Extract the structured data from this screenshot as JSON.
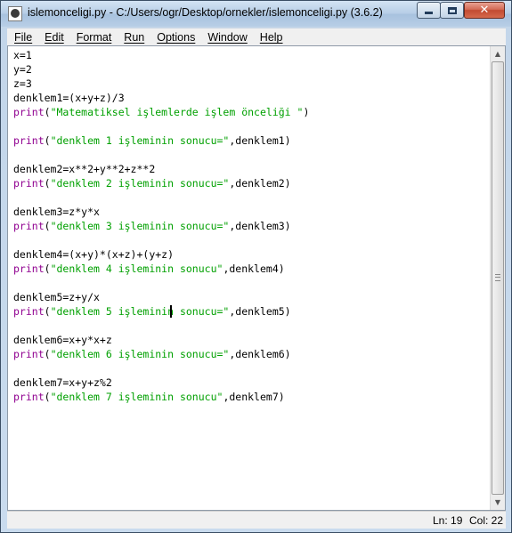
{
  "window": {
    "title": "islemonceligi.py - C:/Users/ogr/Desktop/ornekler/islemonceligi.py (3.6.2)"
  },
  "menubar": {
    "items": [
      {
        "label": "File"
      },
      {
        "label": "Edit"
      },
      {
        "label": "Format"
      },
      {
        "label": "Run"
      },
      {
        "label": "Options"
      },
      {
        "label": "Window"
      },
      {
        "label": "Help"
      }
    ]
  },
  "editor": {
    "lines": [
      [
        {
          "t": "x=1",
          "c": "txt"
        }
      ],
      [
        {
          "t": "y=2",
          "c": "txt"
        }
      ],
      [
        {
          "t": "z=3",
          "c": "txt"
        }
      ],
      [
        {
          "t": "denklem1=(x+y+z)/3",
          "c": "txt"
        }
      ],
      [
        {
          "t": "print",
          "c": "kw"
        },
        {
          "t": "(",
          "c": "txt"
        },
        {
          "t": "\"Matematiksel işlemlerde işlem önceliği \"",
          "c": "str"
        },
        {
          "t": ")",
          "c": "txt"
        }
      ],
      [],
      [
        {
          "t": "print",
          "c": "kw"
        },
        {
          "t": "(",
          "c": "txt"
        },
        {
          "t": "\"denklem 1 işleminin sonucu=\"",
          "c": "str"
        },
        {
          "t": ",denklem1)",
          "c": "txt"
        }
      ],
      [],
      [
        {
          "t": "denklem2=x**2+y**2+z**2",
          "c": "txt"
        }
      ],
      [
        {
          "t": "print",
          "c": "kw"
        },
        {
          "t": "(",
          "c": "txt"
        },
        {
          "t": "\"denklem 2 işleminin sonucu=\"",
          "c": "str"
        },
        {
          "t": ",denklem2)",
          "c": "txt"
        }
      ],
      [],
      [
        {
          "t": "denklem3=z*y*x",
          "c": "txt"
        }
      ],
      [
        {
          "t": "print",
          "c": "kw"
        },
        {
          "t": "(",
          "c": "txt"
        },
        {
          "t": "\"denklem 3 işleminin sonucu=\"",
          "c": "str"
        },
        {
          "t": ",denklem3)",
          "c": "txt"
        }
      ],
      [],
      [
        {
          "t": "denklem4=(x+y)*(x+z)+(y+z)",
          "c": "txt"
        }
      ],
      [
        {
          "t": "print",
          "c": "kw"
        },
        {
          "t": "(",
          "c": "txt"
        },
        {
          "t": "\"denklem 4 işleminin sonucu\"",
          "c": "str"
        },
        {
          "t": ",denklem4)",
          "c": "txt"
        }
      ],
      [],
      [
        {
          "t": "denklem5=z+y/x",
          "c": "txt"
        }
      ],
      [
        {
          "t": "print",
          "c": "kw"
        },
        {
          "t": "(",
          "c": "txt"
        },
        {
          "t": "\"denklem 5 işleminin sonucu=\"",
          "c": "str"
        },
        {
          "t": ",denklem5)",
          "c": "txt"
        }
      ],
      [],
      [
        {
          "t": "denklem6=x+y*x+z",
          "c": "txt"
        }
      ],
      [
        {
          "t": "print",
          "c": "kw"
        },
        {
          "t": "(",
          "c": "txt"
        },
        {
          "t": "\"denklem 6 işleminin sonucu=\"",
          "c": "str"
        },
        {
          "t": ",denklem6)",
          "c": "txt"
        }
      ],
      [],
      [
        {
          "t": "denklem7=x+y+z%2",
          "c": "txt"
        }
      ],
      [
        {
          "t": "print",
          "c": "kw"
        },
        {
          "t": "(",
          "c": "txt"
        },
        {
          "t": "\"denklem 7 işleminin sonucu\"",
          "c": "str"
        },
        {
          "t": ",denklem7)",
          "c": "txt"
        }
      ]
    ]
  },
  "statusbar": {
    "line": "Ln: 19",
    "col": "Col: 22"
  },
  "colors": {
    "keyword": "#900090",
    "string": "#00a000",
    "text": "#000000"
  }
}
